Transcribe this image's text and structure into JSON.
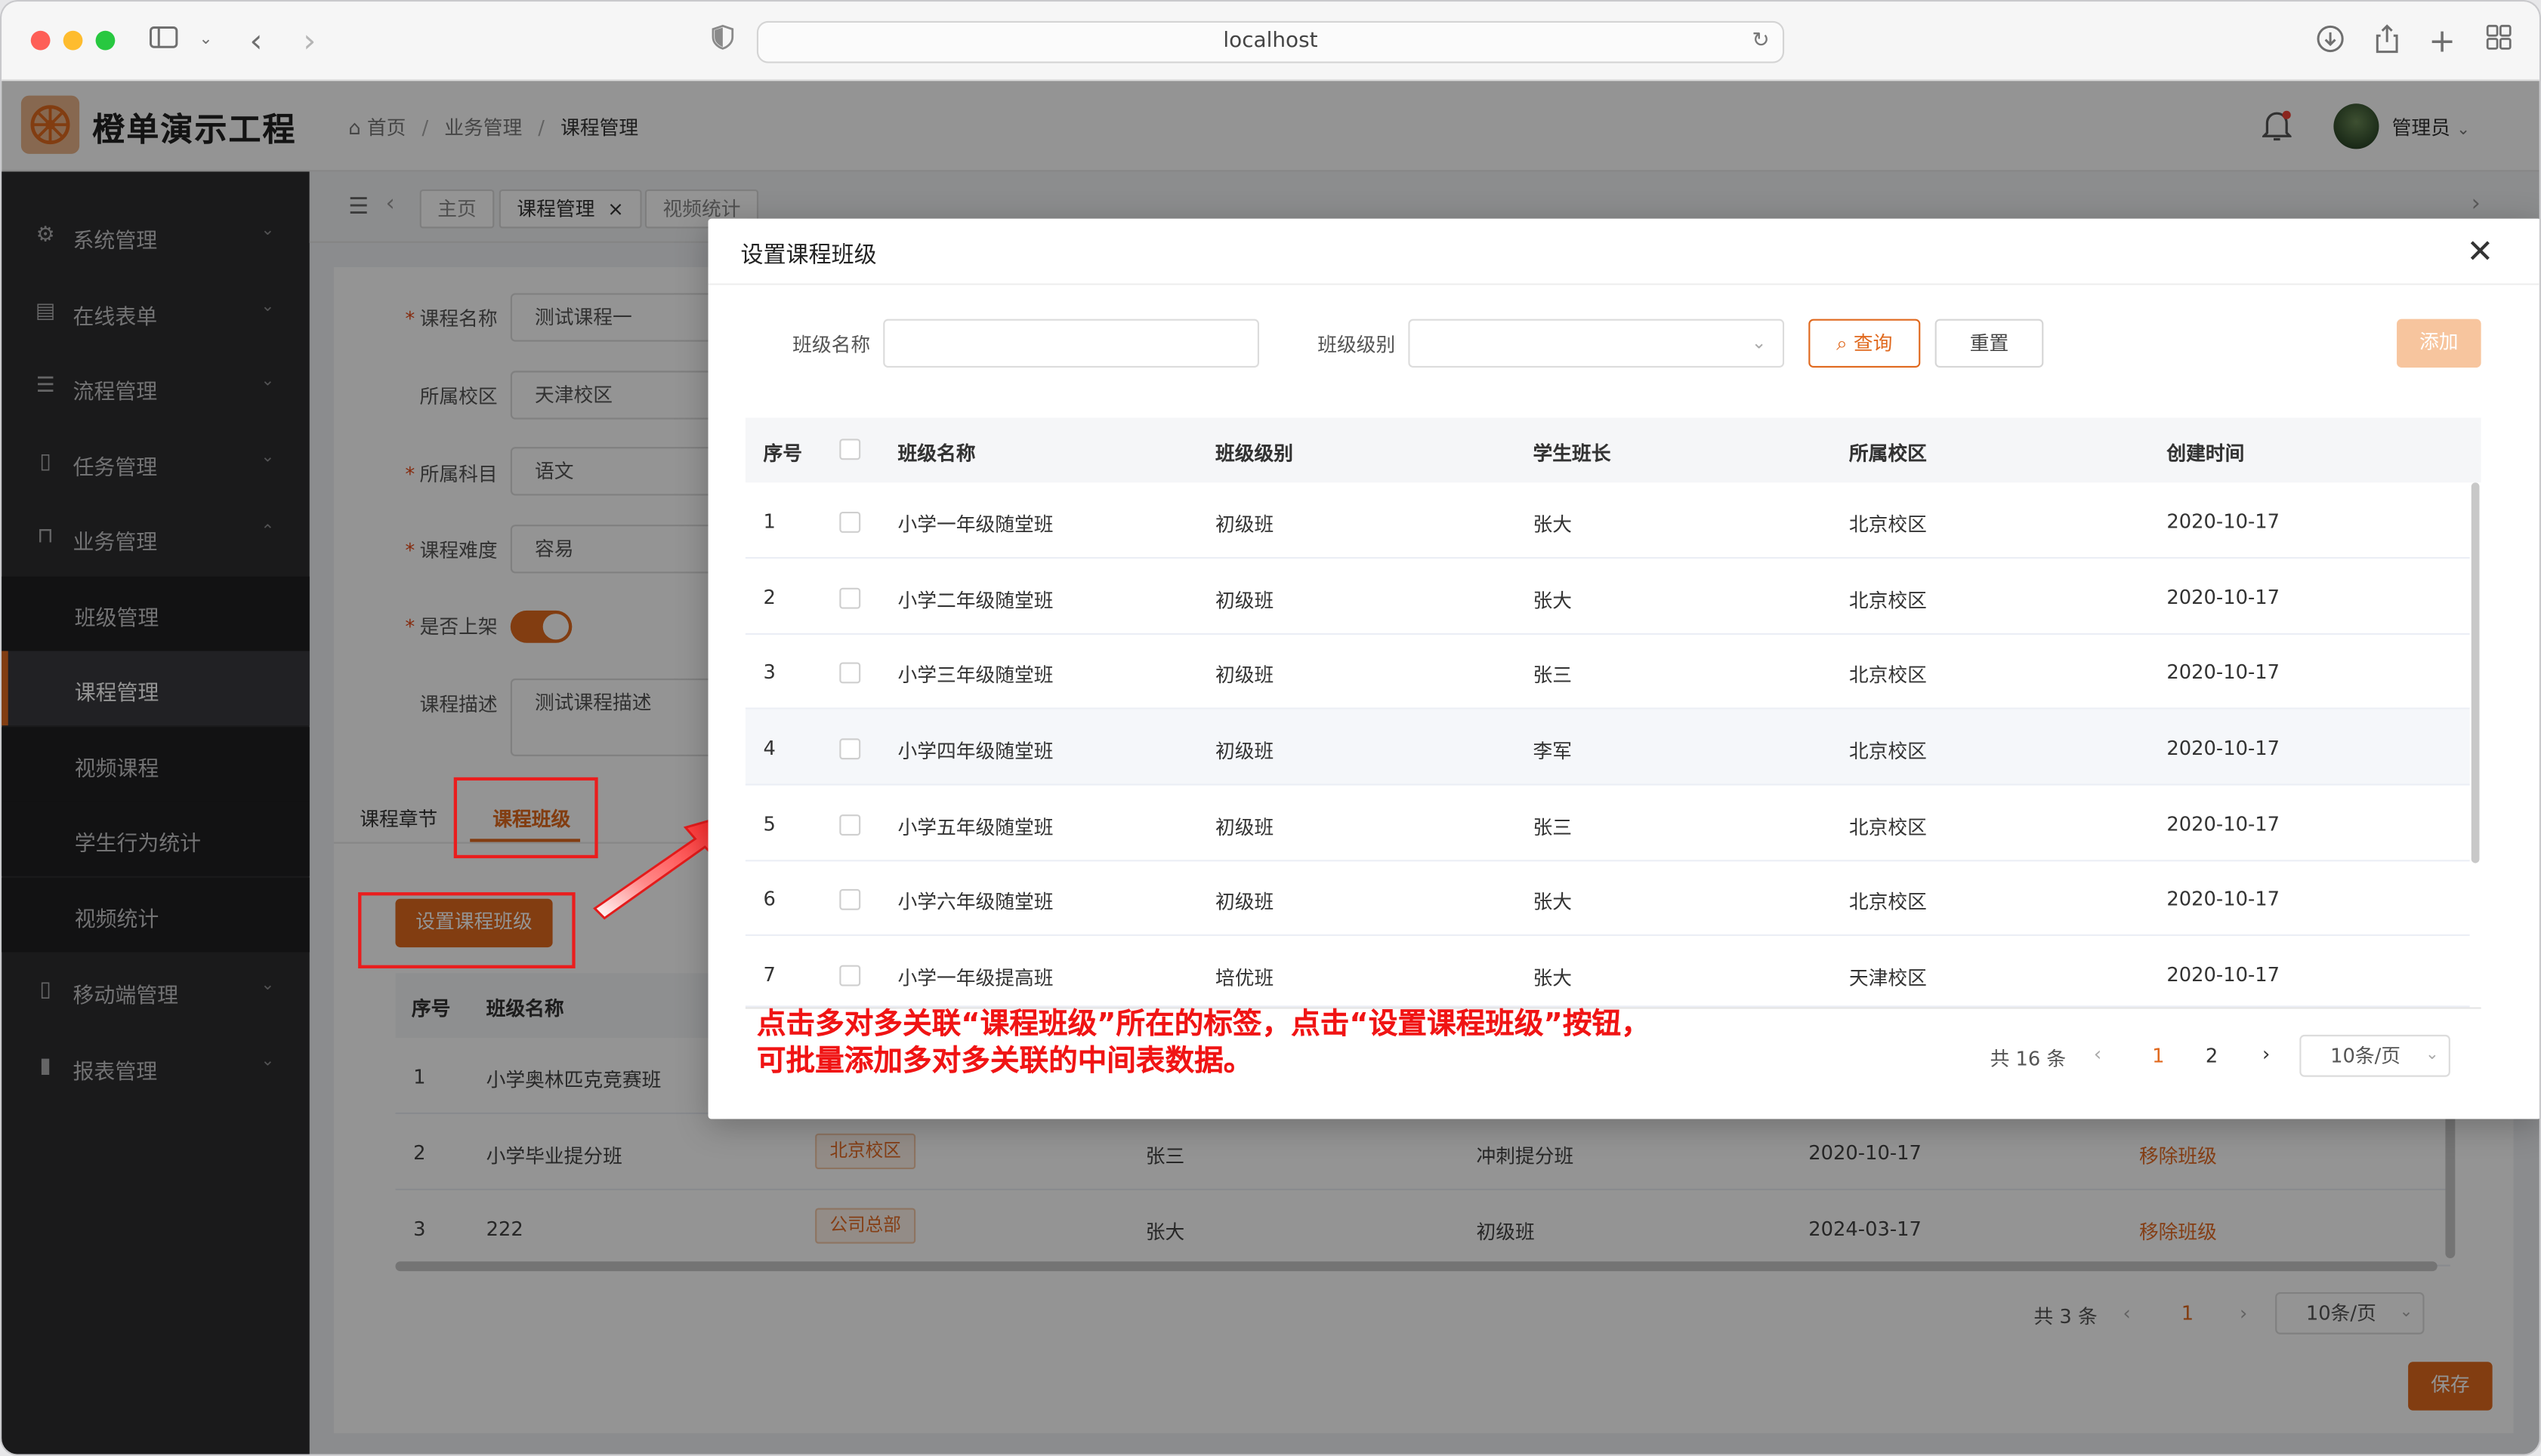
{
  "browser": {
    "url": "localhost"
  },
  "header": {
    "app_title": "橙单演示工程",
    "breadcrumb": [
      "首页",
      "业务管理",
      "课程管理"
    ],
    "separator": "/",
    "user_name": "管理员"
  },
  "sidebar": {
    "items": [
      {
        "label": "系统管理",
        "icon": "gear-icon"
      },
      {
        "label": "在线表单",
        "icon": "form-icon"
      },
      {
        "label": "流程管理",
        "icon": "sliders-icon"
      },
      {
        "label": "任务管理",
        "icon": "doc-icon"
      },
      {
        "label": "业务管理",
        "icon": "bag-icon"
      },
      {
        "label": "移动端管理",
        "icon": "mobile-icon"
      },
      {
        "label": "报表管理",
        "icon": "chart-icon"
      }
    ],
    "subitems": [
      "班级管理",
      "课程管理",
      "视频课程",
      "学生行为统计",
      "视频统计"
    ],
    "active_sub": "课程管理"
  },
  "tabs": [
    {
      "label": "主页"
    },
    {
      "label": "课程管理",
      "close": "×"
    },
    {
      "label": "视频统计"
    }
  ],
  "form": {
    "course_name_label": "课程名称",
    "course_name": "测试课程一",
    "campus_label": "所属校区",
    "campus": "天津校区",
    "subject_label": "所属科目",
    "subject": "语文",
    "difficulty_label": "课程难度",
    "difficulty": "容易",
    "on_shelf_label": "是否上架",
    "on_shelf": true,
    "desc_label": "课程描述",
    "desc": "测试课程描述",
    "save_label": "保存"
  },
  "course_tabs": {
    "chapter": "课程章节",
    "class": "课程班级"
  },
  "set_class_button": "设置课程班级",
  "class_table": {
    "headers": [
      "序号",
      "班级名称"
    ],
    "rows": [
      {
        "idx": "1",
        "name": "小学奥林匹克竞赛班"
      },
      {
        "idx": "2",
        "name": "小学毕业提分班",
        "campus": "北京校区",
        "leader": "张三",
        "level": "冲刺提分班",
        "date": "2020-10-17",
        "action": "移除班级"
      },
      {
        "idx": "3",
        "name": "222",
        "campus": "公司总部",
        "leader": "张大",
        "level": "初级班",
        "date": "2024-03-17",
        "action": "移除班级"
      }
    ],
    "total": "共 3 条",
    "page": "1",
    "page_size": "10条/页"
  },
  "dialog": {
    "title": "设置课程班级",
    "filter": {
      "name_label": "班级名称",
      "name_value": "",
      "level_label": "班级级别",
      "level_value": ""
    },
    "query_label": "查询",
    "reset_label": "重置",
    "add_label": "添加",
    "headers": [
      "序号",
      "班级名称",
      "班级级别",
      "学生班长",
      "所属校区",
      "创建时间"
    ],
    "rows": [
      {
        "idx": "1",
        "name": "小学一年级随堂班",
        "level": "初级班",
        "leader": "张大",
        "campus": "北京校区",
        "date": "2020-10-17"
      },
      {
        "idx": "2",
        "name": "小学二年级随堂班",
        "level": "初级班",
        "leader": "张大",
        "campus": "北京校区",
        "date": "2020-10-17"
      },
      {
        "idx": "3",
        "name": "小学三年级随堂班",
        "level": "初级班",
        "leader": "张三",
        "campus": "北京校区",
        "date": "2020-10-17"
      },
      {
        "idx": "4",
        "name": "小学四年级随堂班",
        "level": "初级班",
        "leader": "李军",
        "campus": "北京校区",
        "date": "2020-10-17"
      },
      {
        "idx": "5",
        "name": "小学五年级随堂班",
        "level": "初级班",
        "leader": "张三",
        "campus": "北京校区",
        "date": "2020-10-17"
      },
      {
        "idx": "6",
        "name": "小学六年级随堂班",
        "level": "初级班",
        "leader": "张大",
        "campus": "北京校区",
        "date": "2020-10-17"
      },
      {
        "idx": "7",
        "name": "小学一年级提高班",
        "level": "培优班",
        "leader": "张大",
        "campus": "天津校区",
        "date": "2020-10-17"
      }
    ],
    "total": "共 16 条",
    "pages": [
      "1",
      "2"
    ],
    "page_size": "10条/页"
  },
  "annotation": {
    "line1": "点击多对多关联“课程班级”所在的标签，点击“设置课程班级”按钮，",
    "line2": "可批量添加多对多关联的中间表数据。"
  },
  "colors": {
    "accent": "#e0691e",
    "sidebar": "#2d2d30",
    "annotation": "#f01414"
  }
}
